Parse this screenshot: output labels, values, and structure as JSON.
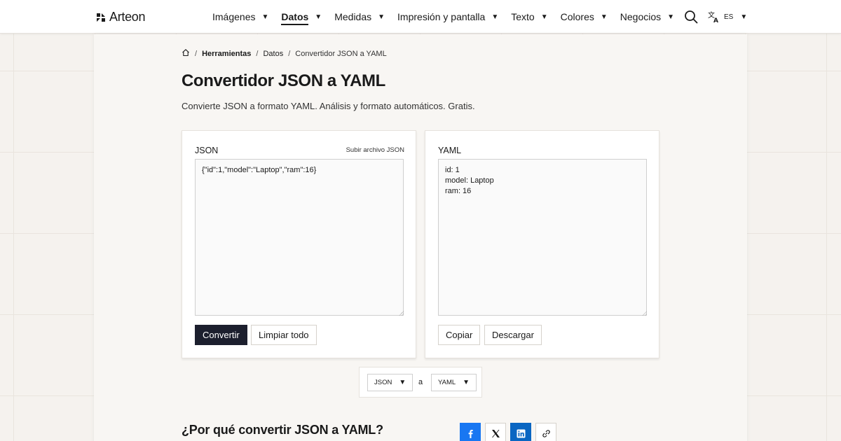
{
  "brand": {
    "name": "Arteon"
  },
  "nav": {
    "items": [
      {
        "label": "Imágenes"
      },
      {
        "label": "Datos"
      },
      {
        "label": "Medidas"
      },
      {
        "label": "Impresión y pantalla"
      },
      {
        "label": "Texto"
      },
      {
        "label": "Colores"
      },
      {
        "label": "Negocios"
      }
    ],
    "active": "Datos",
    "language": "ES",
    "caret": "▼"
  },
  "breadcrumb": {
    "items": [
      "Herramientas",
      "Datos",
      "Convertidor JSON a YAML"
    ],
    "separator": "/"
  },
  "page": {
    "title": "Convertidor JSON a YAML",
    "subtitle": "Convierte JSON a formato YAML. Análisis y formato automáticos. Gratis."
  },
  "input_panel": {
    "title": "JSON",
    "upload_label": "Subir archivo JSON",
    "value": "{\"id\":1,\"model\":\"Laptop\",\"ram\":16}",
    "convert_label": "Convertir",
    "clear_label": "Limpiar todo"
  },
  "output_panel": {
    "title": "YAML",
    "value": "id: 1\nmodel: Laptop\nram: 16",
    "copy_label": "Copiar",
    "download_label": "Descargar"
  },
  "format_selector": {
    "from": "JSON",
    "connector": "a",
    "to": "YAML"
  },
  "section": {
    "title": "¿Por qué convertir JSON a YAML?"
  },
  "share": {
    "buttons": [
      "facebook-icon",
      "x-icon",
      "linkedin-icon",
      "link-icon"
    ]
  },
  "colors": {
    "primary_button": "#1c1f2e",
    "facebook": "#1877f2",
    "linkedin": "#0a66c2",
    "background": "#f5f2ee"
  }
}
